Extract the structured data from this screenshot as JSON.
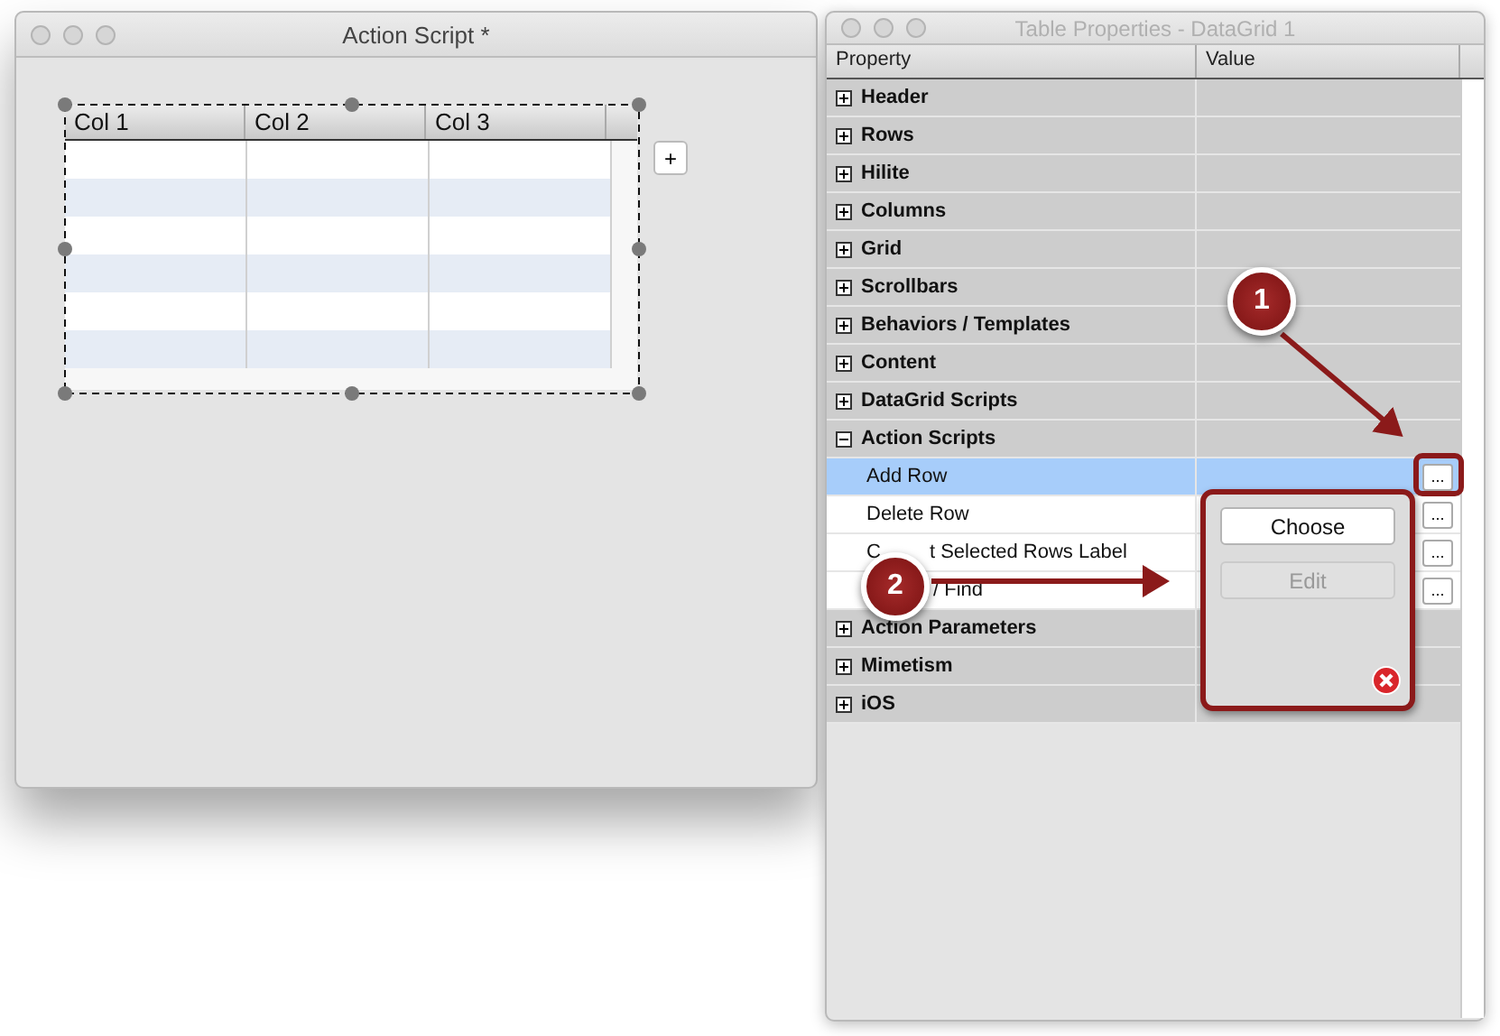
{
  "editor_window": {
    "title": "Action Script *",
    "grid": {
      "columns": [
        "Col 1",
        "Col 2",
        "Col 3"
      ],
      "rows": [
        {
          "alt": false
        },
        {
          "alt": true
        },
        {
          "alt": false
        },
        {
          "alt": true
        },
        {
          "alt": false
        },
        {
          "alt": true
        }
      ]
    },
    "add_button": "+"
  },
  "properties_window": {
    "title": "Table Properties - DataGrid 1",
    "columns": [
      "Property",
      "Value"
    ],
    "rows": [
      {
        "kind": "group",
        "label": "Header",
        "expanded": false
      },
      {
        "kind": "group",
        "label": "Rows",
        "expanded": false
      },
      {
        "kind": "group",
        "label": "Hilite",
        "expanded": false
      },
      {
        "kind": "group",
        "label": "Columns",
        "expanded": false
      },
      {
        "kind": "group",
        "label": "Grid",
        "expanded": false
      },
      {
        "kind": "group",
        "label": "Scrollbars",
        "expanded": false
      },
      {
        "kind": "group",
        "label": "Behaviors / Templates",
        "expanded": false
      },
      {
        "kind": "group",
        "label": "Content",
        "expanded": false
      },
      {
        "kind": "group",
        "label": "DataGrid Scripts",
        "expanded": false
      },
      {
        "kind": "group",
        "label": "Action Scripts",
        "expanded": true
      },
      {
        "kind": "item",
        "label": "Add Row",
        "selected": true,
        "button": "..."
      },
      {
        "kind": "item",
        "label": "Delete Row",
        "selected": false,
        "button": "..."
      },
      {
        "kind": "item",
        "label_head": "C",
        "label": "t Selected Rows Label",
        "selected": false,
        "button": "..."
      },
      {
        "kind": "item",
        "label": "/ Find",
        "selected": false,
        "button": "..."
      },
      {
        "kind": "group",
        "label": "Action Parameters",
        "expanded": false
      },
      {
        "kind": "group",
        "label": "Mimetism",
        "expanded": false
      },
      {
        "kind": "group",
        "label": "iOS",
        "expanded": false
      }
    ],
    "popup": {
      "buttons": [
        {
          "label": "Choose",
          "disabled": false
        },
        {
          "label": "Edit",
          "disabled": true
        }
      ]
    }
  },
  "callouts": [
    {
      "number": "1"
    },
    {
      "number": "2"
    }
  ]
}
